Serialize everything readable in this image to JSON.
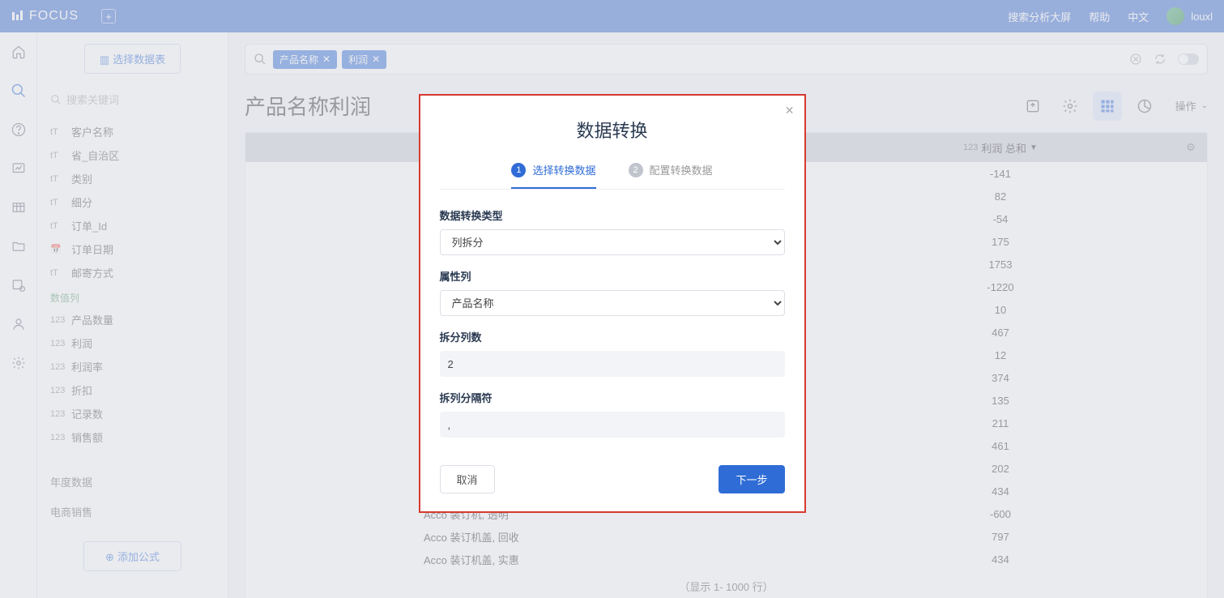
{
  "top": {
    "brand": "FOCUS",
    "links": {
      "search_screen": "搜索分析大屏",
      "help": "帮助",
      "lang": "中文",
      "user": "louxl"
    }
  },
  "left": {
    "select_table": "选择数据表",
    "search_ph": "搜索关键词",
    "attr_fields": [
      {
        "icon": "tT",
        "label": "客户名称"
      },
      {
        "icon": "tT",
        "label": "省_自治区"
      },
      {
        "icon": "tT",
        "label": "类别"
      },
      {
        "icon": "tT",
        "label": "细分"
      },
      {
        "icon": "tT",
        "label": "订单_Id"
      },
      {
        "icon": "📅",
        "label": "订单日期"
      },
      {
        "icon": "tT",
        "label": "邮寄方式"
      }
    ],
    "num_label": "数值列",
    "num_fields": [
      {
        "icon": "123",
        "label": "产品数量"
      },
      {
        "icon": "123",
        "label": "利润"
      },
      {
        "icon": "123",
        "label": "利润率"
      },
      {
        "icon": "123",
        "label": "折扣"
      },
      {
        "icon": "123",
        "label": "记录数"
      },
      {
        "icon": "123",
        "label": "销售额"
      }
    ],
    "datasources": [
      "年度数据",
      "电商销售"
    ],
    "add_formula": "添加公式"
  },
  "query": {
    "chips": [
      "产品名称",
      "利润"
    ]
  },
  "page_title": "产品名称利润",
  "op_label": "操作",
  "table": {
    "col2_prefix": "123",
    "col2": "利润 总和",
    "rows": [
      {
        "name": "",
        "val": "-141"
      },
      {
        "name": "",
        "val": "82"
      },
      {
        "name": "",
        "val": "-54"
      },
      {
        "name": "",
        "val": "175"
      },
      {
        "name": "",
        "val": "1753"
      },
      {
        "name": "",
        "val": "-1220"
      },
      {
        "name": "",
        "val": "10"
      },
      {
        "name": "",
        "val": "467"
      },
      {
        "name": "",
        "val": "12"
      },
      {
        "name": "",
        "val": "374"
      },
      {
        "name": "",
        "val": "135"
      },
      {
        "name": "",
        "val": "211"
      },
      {
        "name": "",
        "val": "461"
      },
      {
        "name": "",
        "val": "202"
      },
      {
        "name": "",
        "val": "434"
      },
      {
        "name": "Acco 装订机, 透明",
        "val": "-600"
      },
      {
        "name": "Acco 装订机盖, 回收",
        "val": "797"
      },
      {
        "name": "Acco 装订机盖, 实惠",
        "val": "434"
      }
    ],
    "footer": "（显示 1- 1000 行）"
  },
  "modal": {
    "title": "数据转换",
    "step1": "选择转换数据",
    "step2": "配置转换数据",
    "f1_label": "数据转换类型",
    "f1_value": "列拆分",
    "f2_label": "属性列",
    "f2_value": "产品名称",
    "f3_label": "拆分列数",
    "f3_value": "2",
    "f4_label": "拆列分隔符",
    "f4_value": ",",
    "cancel": "取消",
    "next": "下一步"
  }
}
